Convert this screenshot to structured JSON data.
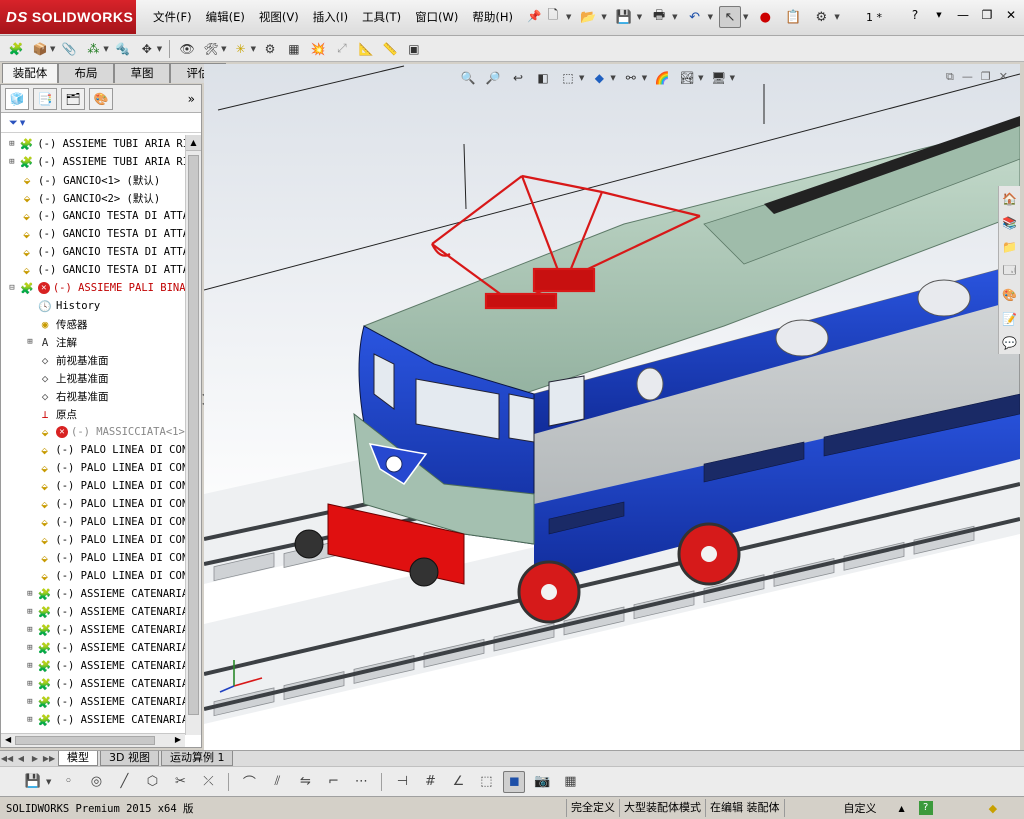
{
  "app": {
    "logo_brand": "SOLIDWORKS",
    "logo_mark": "DS",
    "document_title": "1 *"
  },
  "menu": [
    "文件(F)",
    "编辑(E)",
    "视图(V)",
    "插入(I)",
    "工具(T)",
    "窗口(W)",
    "帮助(H)"
  ],
  "command_manager_tabs": [
    {
      "label": "装配体",
      "active": true
    },
    {
      "label": "布局",
      "active": false
    },
    {
      "label": "草图",
      "active": false
    },
    {
      "label": "评估",
      "active": false
    }
  ],
  "tree": [
    {
      "label": "(-) ASSIEME TUBI ARIA RI",
      "expand": "+",
      "icon": "assembly-icon",
      "color": "normal"
    },
    {
      "label": "(-) ASSIEME TUBI ARIA RI",
      "expand": "+",
      "icon": "assembly-icon",
      "color": "normal"
    },
    {
      "label": "(-) GANCIO<1> (默认)",
      "expand": "",
      "icon": "part-icon",
      "color": "normal"
    },
    {
      "label": "(-) GANCIO<2> (默认)",
      "expand": "",
      "icon": "part-icon",
      "color": "normal"
    },
    {
      "label": "(-) GANCIO TESTA DI ATTA",
      "expand": "",
      "icon": "part-icon",
      "color": "normal"
    },
    {
      "label": "(-) GANCIO TESTA DI ATTA",
      "expand": "",
      "icon": "part-icon",
      "color": "normal"
    },
    {
      "label": "(-) GANCIO TESTA DI ATTA",
      "expand": "",
      "icon": "part-icon",
      "color": "normal"
    },
    {
      "label": "(-) GANCIO TESTA DI ATTA",
      "expand": "",
      "icon": "part-icon",
      "color": "normal"
    },
    {
      "label": "(-) ASSIEME PALI BINA",
      "expand": "−",
      "icon": "assembly-icon",
      "color": "red",
      "error": true
    },
    {
      "label": "History",
      "expand": "",
      "icon": "history-icon",
      "color": "normal",
      "indent": 1
    },
    {
      "label": "传感器",
      "expand": "",
      "icon": "sensor-icon",
      "color": "normal",
      "indent": 1
    },
    {
      "label": "注解",
      "expand": "+",
      "icon": "annotation-icon",
      "color": "normal",
      "indent": 1
    },
    {
      "label": "前视基准面",
      "expand": "",
      "icon": "plane-icon",
      "color": "normal",
      "indent": 1
    },
    {
      "label": "上视基准面",
      "expand": "",
      "icon": "plane-icon",
      "color": "normal",
      "indent": 1
    },
    {
      "label": "右视基准面",
      "expand": "",
      "icon": "plane-icon",
      "color": "normal",
      "indent": 1
    },
    {
      "label": "原点",
      "expand": "",
      "icon": "origin-icon",
      "color": "normal",
      "indent": 1
    },
    {
      "label": "(-) MASSICCIATA<1>",
      "expand": "",
      "icon": "part-icon",
      "color": "grey",
      "indent": 1,
      "error": true
    },
    {
      "label": "(-) PALO LINEA DI CON",
      "expand": "",
      "icon": "part-icon",
      "color": "normal",
      "indent": 1
    },
    {
      "label": "(-) PALO LINEA DI CON",
      "expand": "",
      "icon": "part-icon",
      "color": "normal",
      "indent": 1
    },
    {
      "label": "(-) PALO LINEA DI CON",
      "expand": "",
      "icon": "part-icon",
      "color": "normal",
      "indent": 1
    },
    {
      "label": "(-) PALO LINEA DI CON",
      "expand": "",
      "icon": "part-icon",
      "color": "normal",
      "indent": 1
    },
    {
      "label": "(-) PALO LINEA DI CON",
      "expand": "",
      "icon": "part-icon",
      "color": "normal",
      "indent": 1
    },
    {
      "label": "(-) PALO LINEA DI CON",
      "expand": "",
      "icon": "part-icon",
      "color": "normal",
      "indent": 1
    },
    {
      "label": "(-) PALO LINEA DI CON",
      "expand": "",
      "icon": "part-icon",
      "color": "normal",
      "indent": 1
    },
    {
      "label": "(-) PALO LINEA DI CON",
      "expand": "",
      "icon": "part-icon",
      "color": "normal",
      "indent": 1
    },
    {
      "label": "(-) ASSIEME CATENARIA",
      "expand": "+",
      "icon": "assembly-icon",
      "color": "normal",
      "indent": 1
    },
    {
      "label": "(-) ASSIEME CATENARIA",
      "expand": "+",
      "icon": "assembly-icon",
      "color": "normal",
      "indent": 1
    },
    {
      "label": "(-) ASSIEME CATENARIA",
      "expand": "+",
      "icon": "assembly-icon",
      "color": "normal",
      "indent": 1
    },
    {
      "label": "(-) ASSIEME CATENARIA",
      "expand": "+",
      "icon": "assembly-icon",
      "color": "normal",
      "indent": 1
    },
    {
      "label": "(-) ASSIEME CATENARIA",
      "expand": "+",
      "icon": "assembly-icon",
      "color": "normal",
      "indent": 1
    },
    {
      "label": "(-) ASSIEME CATENARIA",
      "expand": "+",
      "icon": "assembly-icon",
      "color": "normal",
      "indent": 1
    },
    {
      "label": "(-) ASSIEME CATENARIA",
      "expand": "+",
      "icon": "assembly-icon",
      "color": "normal",
      "indent": 1
    },
    {
      "label": "(-) ASSIEME CATENARIA",
      "expand": "+",
      "icon": "assembly-icon",
      "color": "normal",
      "indent": 1
    }
  ],
  "model_tabs": [
    {
      "label": "模型",
      "active": true
    },
    {
      "label": "3D 视图",
      "active": false
    },
    {
      "label": "运动算例 1",
      "active": false
    }
  ],
  "status": {
    "app_version": "SOLIDWORKS Premium 2015 x64 版",
    "cells": [
      "完全定义",
      "大型装配体模式",
      "在编辑 装配体"
    ],
    "units": "自定义"
  },
  "colors": {
    "loco_body_blue": "#1a3fc4",
    "loco_roof_green": "#a8c4b4",
    "loco_side_grey": "#c4c8c8",
    "pantograph_red": "#d81818",
    "bumper_red": "#e01010",
    "title_red": "#c8141c"
  }
}
